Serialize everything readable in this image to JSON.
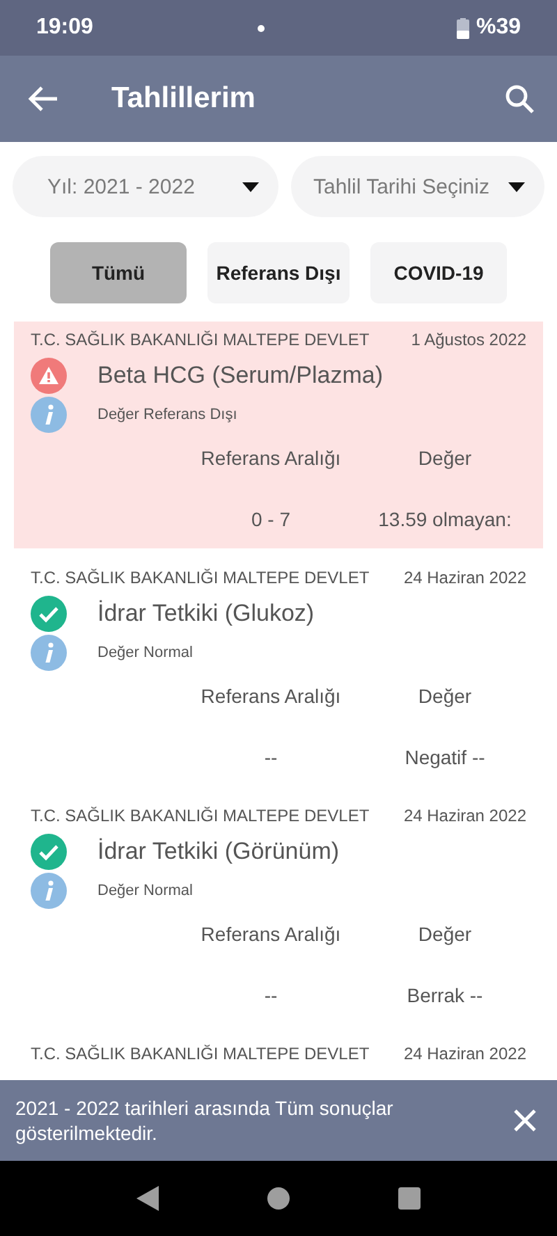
{
  "status_bar": {
    "time": "19:09",
    "battery": "%39"
  },
  "app_bar": {
    "title": "Tahlillerim"
  },
  "dropdowns": [
    {
      "value": "Yıl: 2021 - 2022"
    },
    {
      "value": "Tahlil Tarihi Seçiniz"
    }
  ],
  "filters": [
    {
      "label": "Tümü",
      "selected": true
    },
    {
      "label": "Referans Dışı",
      "selected": false
    },
    {
      "label": "COVID-19",
      "selected": false
    }
  ],
  "results": [
    {
      "kind": "abnormal",
      "hospital": "T.C. SAĞLIK BAKANLIĞI MALTEPE DEVLET",
      "date": "1 Ağustos 2022",
      "test": "Beta HCG (Serum/Plazma)",
      "note": "Değer Referans Dışı",
      "range_label": "Referans Aralığı",
      "value_label": "Değer",
      "range": "0 - 7",
      "value": "13.59 olmayan:"
    },
    {
      "kind": "normal",
      "hospital": "T.C. SAĞLIK BAKANLIĞI MALTEPE DEVLET",
      "date": "24 Haziran 2022",
      "test": "İdrar Tetkiki (Glukoz)",
      "note": "Değer Normal",
      "range_label": "Referans Aralığı",
      "value_label": "Değer",
      "range": "--",
      "value": "Negatif --"
    },
    {
      "kind": "normal",
      "hospital": "T.C. SAĞLIK BAKANLIĞI MALTEPE DEVLET",
      "date": "24 Haziran 2022",
      "test": "İdrar Tetkiki (Görünüm)",
      "note": "Değer Normal",
      "range_label": "Referans Aralığı",
      "value_label": "Değer",
      "range": "--",
      "value": "Berrak --"
    },
    {
      "kind": "header_only",
      "hospital": "T.C. SAĞLIK BAKANLIĞI MALTEPE DEVLET",
      "date": "24 Haziran 2022"
    }
  ],
  "snackbar": {
    "message": "2021 - 2022 tarihleri arasında Tüm sonuçlar gösterilmektedir."
  }
}
